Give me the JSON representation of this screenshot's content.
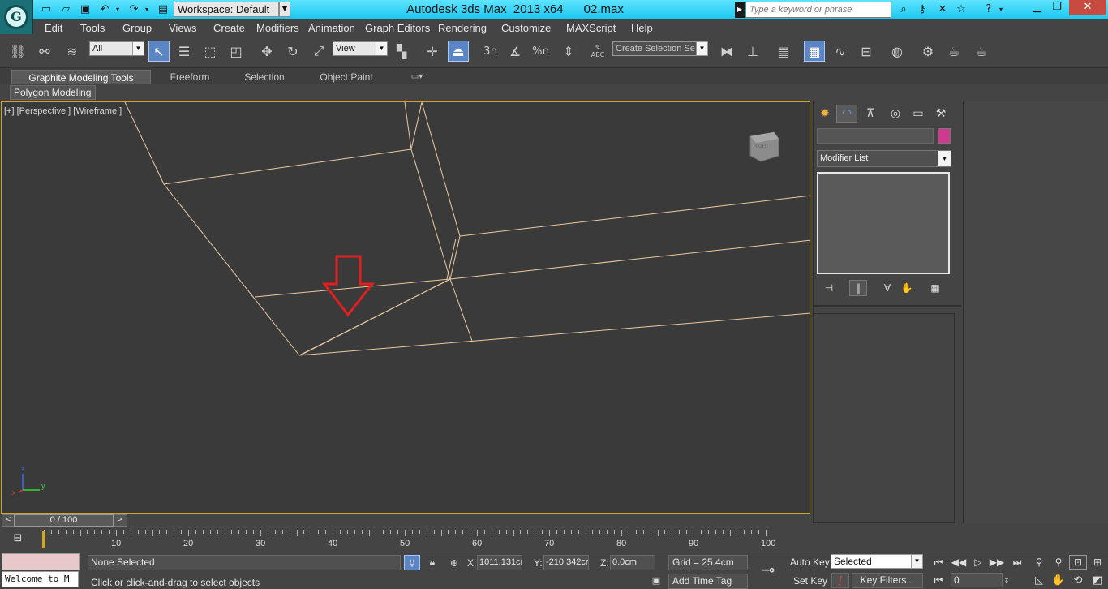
{
  "title_bar": {
    "workspace": "Workspace: Default",
    "app_title": "Autodesk 3ds Max  2013 x64      02.max",
    "search_placeholder": "Type a keyword or phrase",
    "accent": "#19c6ee"
  },
  "menu": [
    "Edit",
    "Tools",
    "Group",
    "Views",
    "Create",
    "Modifiers",
    "Animation",
    "Graph Editors",
    "Rendering",
    "Customize",
    "MAXScript",
    "Help"
  ],
  "main_toolbar": {
    "selection_filter": "All",
    "reference_coord": "View",
    "named_selection_placeholder": "Create Selection Se",
    "snap_labels": {
      "snap": "3",
      "percent": "%",
      "abc": "ABC"
    }
  },
  "ribbon": {
    "tabs": [
      "Graphite Modeling Tools",
      "Freeform",
      "Selection",
      "Object Paint"
    ],
    "active_tab": 0,
    "panel": "Polygon Modeling"
  },
  "viewport": {
    "label": "[+] [Perspective ] [Wireframe ]",
    "viewcube_face": "RIGHT",
    "axis_labels": {
      "z": "z",
      "x": "x",
      "y": "y"
    },
    "wire_color": "#e9c9a3",
    "arrow_color": "#e02020",
    "border_color": "#c8a830"
  },
  "command_panel": {
    "name_value": "",
    "object_color": "#cf3a8f",
    "modifier_list": "Modifier List"
  },
  "time_slider": {
    "counter": "0 / 100",
    "prev": "<",
    "next": ">"
  },
  "trackbar": {
    "ticks": [
      "10",
      "20",
      "30",
      "40",
      "50",
      "60",
      "70",
      "80",
      "90",
      "100"
    ]
  },
  "status": {
    "maxscript_listener": "Welcome to M",
    "selection": "None Selected",
    "prompt": "Click or click-and-drag to select objects",
    "x_label": "X:",
    "x_value": "1011.131cr",
    "y_label": "Y:",
    "y_value": "-210.342cm",
    "z_label": "Z:",
    "z_value": "0.0cm",
    "grid": "Grid = 25.4cm",
    "add_time_tag": "Add Time Tag",
    "auto_key": "Auto Key",
    "set_key": "Set Key",
    "key_mode": "Selected",
    "key_filters": "Key Filters...",
    "frame": "0"
  }
}
